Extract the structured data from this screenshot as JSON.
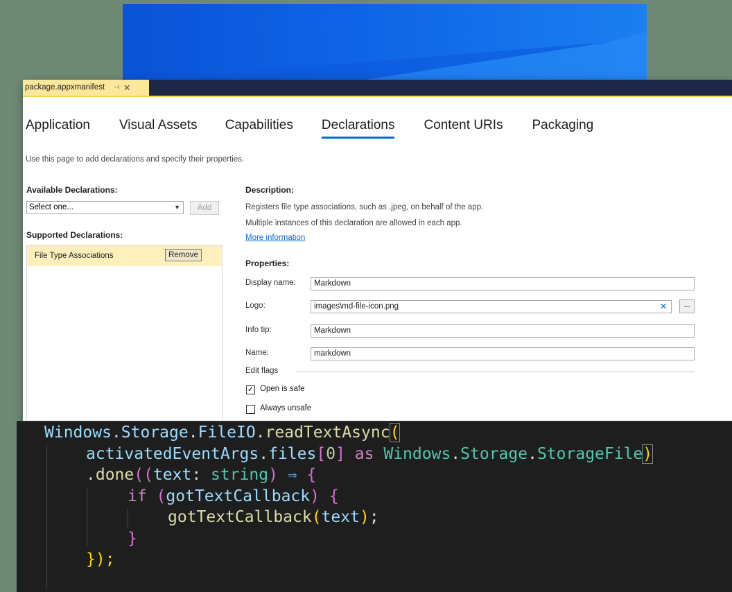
{
  "doc_tab": {
    "title": "package.appxmanifest",
    "pin": "⊣",
    "close": "✕"
  },
  "tabs": [
    "Application",
    "Visual Assets",
    "Capabilities",
    "Declarations",
    "Content URIs",
    "Packaging"
  ],
  "active_tab": "Declarations",
  "intro": "Use this page to add declarations and specify their properties.",
  "available": {
    "heading": "Available Declarations:",
    "select_value": "Select one...",
    "add_label": "Add"
  },
  "supported": {
    "heading": "Supported Declarations:",
    "items": [
      {
        "label": "File Type Associations",
        "remove_label": "Remove"
      }
    ]
  },
  "description": {
    "heading": "Description:",
    "line1": "Registers file type associations, such as .jpeg, on behalf of the app.",
    "line2": "Multiple instances of this declaration are allowed in each app.",
    "more_link": "More information"
  },
  "properties": {
    "heading": "Properties:",
    "display_name_label": "Display name:",
    "display_name": "Markdown",
    "logo_label": "Logo:",
    "logo": "images\\md-file-icon.png",
    "logo_clear": "✕",
    "browse_label": "...",
    "info_tip_label": "Info tip:",
    "info_tip": "Markdown",
    "name_label": "Name:",
    "name": "markdown",
    "edit_flags": "Edit flags",
    "open_is_safe": "Open is safe",
    "open_is_safe_checked": true,
    "always_unsafe": "Always unsafe",
    "always_unsafe_checked": false
  },
  "code": {
    "line1": {
      "ns1": "Windows",
      "dot1": ".",
      "ns2": "Storage",
      "dot2": ".",
      "ns3": "FileIO",
      "dot3": ".",
      "fn": "readTextAsync",
      "open": "("
    },
    "line2": {
      "obj": "activatedEventArgs",
      "dot": ".",
      "prop": "files",
      "lb": "[",
      "idx": "0",
      "rb": "]",
      "as": "as",
      "t1": "Windows",
      "d1": ".",
      "t2": "Storage",
      "d2": ".",
      "t3": "StorageFile",
      "close": ")"
    },
    "line3": {
      "dot": ".",
      "fn": "done",
      "open": "((",
      "param": "text",
      "colon": ": ",
      "type": "string",
      "close": ")",
      "arrow": " ⇒ ",
      "brace": "{"
    },
    "line4": {
      "kw": "if",
      "open": " (",
      "id": "gotTextCallback",
      "close": ")",
      "brace": " {"
    },
    "line5": {
      "fn": "gotTextCallback",
      "open": "(",
      "arg": "text",
      "close": ")",
      "semi": ";"
    },
    "line6": {
      "brace": "}"
    },
    "line7": {
      "text": "});"
    }
  }
}
